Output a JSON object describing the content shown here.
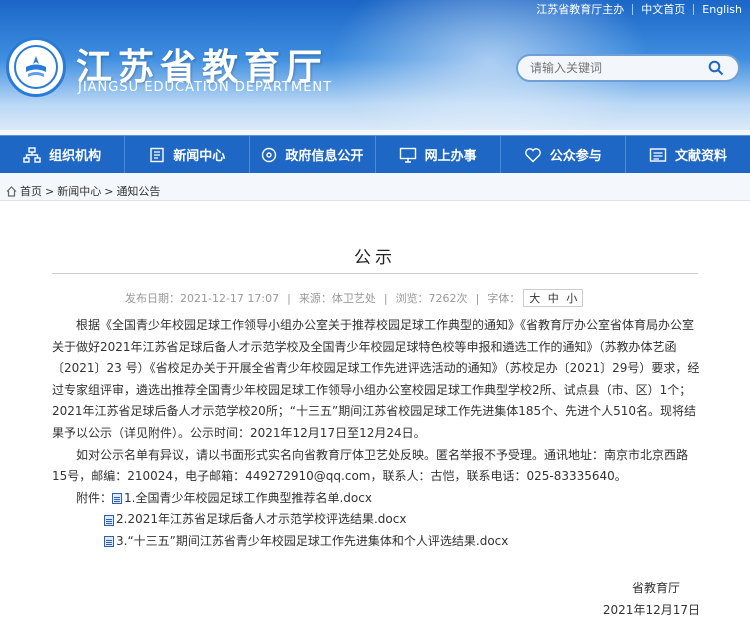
{
  "topbar": {
    "sponsor": "江苏省教育厅主办",
    "chinese_home": "中文首页",
    "english": "English"
  },
  "brand": {
    "title": "江苏省教育厅",
    "subtitle": "JIANGSU EDUCATION DEPARTMENT",
    "accent_color": "#1e67c4"
  },
  "search": {
    "placeholder": "请输入关键词"
  },
  "nav": {
    "items": [
      {
        "label": "组织机构",
        "icon": "org-chart-icon"
      },
      {
        "label": "新闻中心",
        "icon": "news-icon"
      },
      {
        "label": "政府信息公开",
        "icon": "disc-icon"
      },
      {
        "label": "网上办事",
        "icon": "monitor-icon"
      },
      {
        "label": "公众参与",
        "icon": "heart-icon"
      },
      {
        "label": "文献资料",
        "icon": "document-icon"
      }
    ]
  },
  "breadcrumb": {
    "items": [
      "首页",
      "新闻中心",
      "通知公告"
    ],
    "separator": ">"
  },
  "article": {
    "title": "公示",
    "meta": {
      "date": "发布日期：2021-12-17 17:07",
      "source": "来源：体卫艺处",
      "views": "浏览：7262次",
      "font_label": "字体：",
      "font_sizes": [
        "大",
        "中",
        "小"
      ]
    },
    "paragraph1": "根据《全国青少年校园足球工作领导小组办公室关于推荐校园足球工作典型的通知》《省教育厅办公室省体育局办公室关于做好2021年江苏省足球后备人才示范学校及全国青少年校园足球特色校等申报和遴选工作的通知》（苏教办体艺函〔2021〕23 号）《省校足办关于开展全省青少年校园足球工作先进评选活动的通知》（苏校足办〔2021〕29号）要求，经过专家组评审，遴选出推荐全国青少年校园足球工作领导小组办公室校园足球工作典型学校2所、试点县（市、区）1个；2021年江苏省足球后备人才示范学校20所；“十三五”期间江苏省校园足球工作先进集体185个、先进个人510名。现将结果予以公示（详见附件）。公示时间：2021年12月17日至12月24日。",
    "paragraph2": "如对公示名单有异议，请以书面形式实名向省教育厅体卫艺处反映。匿名举报不予受理。通讯地址：南京市北京西路15号，邮编：210024，电子邮箱：449272910@qq.com，联系人：古恺，联系电话：025-83335640。",
    "attachments_label": "附件：",
    "attachments": [
      "1.全国青少年校园足球工作典型推荐名单.docx",
      "2.2021年江苏省足球后备人才示范学校评选结果.docx",
      "3.“十三五”期间江苏省青少年校园足球工作先进集体和个人评选结果.docx"
    ],
    "signature": "省教育厅",
    "sign_date": "2021年12月17日"
  }
}
